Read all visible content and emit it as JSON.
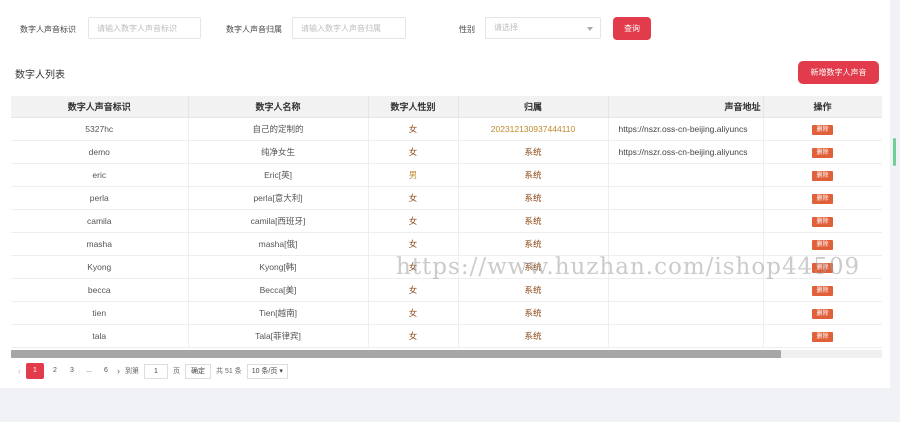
{
  "filters": {
    "id_label": "数字人声音标识",
    "id_placeholder": "请输入数字人声音标识",
    "owner_label": "数字人声音归属",
    "owner_placeholder": "请输入数字人声音归属",
    "gender_label": "性别",
    "gender_placeholder": "请选择",
    "search_button": "查询"
  },
  "section_title": "数字人列表",
  "add_button": "新增数字人声音",
  "table": {
    "headers": [
      "数字人声音标识",
      "数字人名称",
      "数字人性别",
      "归属",
      "声音地址",
      "操作"
    ],
    "rows": [
      {
        "id": "5327hc",
        "name": "自己的定制的",
        "gender": "女",
        "owner": "20231213093744411​0",
        "url": "https://nszr.oss-cn-beijing.aliyuncs",
        "action": "删除"
      },
      {
        "id": "demo",
        "name": "纯净女生",
        "gender": "女",
        "owner": "系统",
        "url": "https://nszr.oss-cn-beijing.aliyuncs",
        "action": "删除"
      },
      {
        "id": "eric",
        "name": "Eric[英]",
        "gender": "男",
        "owner": "系统",
        "url": "",
        "action": "删除"
      },
      {
        "id": "perla",
        "name": "perla[意大利]",
        "gender": "女",
        "owner": "系统",
        "url": "",
        "action": "删除"
      },
      {
        "id": "camila",
        "name": "camila[西班牙]",
        "gender": "女",
        "owner": "系统",
        "url": "",
        "action": "删除"
      },
      {
        "id": "masha",
        "name": "masha[俄]",
        "gender": "女",
        "owner": "系统",
        "url": "",
        "action": "删除"
      },
      {
        "id": "Kyong",
        "name": "Kyong[韩]",
        "gender": "女",
        "owner": "系统",
        "url": "",
        "action": "删除"
      },
      {
        "id": "becca",
        "name": "Becca[美]",
        "gender": "女",
        "owner": "系统",
        "url": "",
        "action": "删除"
      },
      {
        "id": "tien",
        "name": "Tien[越南]",
        "gender": "女",
        "owner": "系统",
        "url": "",
        "action": "删除"
      },
      {
        "id": "tala",
        "name": "Tala[菲律宾]",
        "gender": "女",
        "owner": "系统",
        "url": "",
        "action": "删除"
      }
    ]
  },
  "pagination": {
    "pages": [
      "1",
      "2",
      "3",
      "...",
      "6"
    ],
    "goto_label": "到第",
    "goto_value": "1",
    "page_unit": "页",
    "confirm": "确定",
    "total": "共 51 条",
    "page_size": "10 条/页"
  },
  "watermark": "https://www.huzhan.com/ishop44509",
  "colors": {
    "accent": "#e23b4b",
    "delete": "#e0603a",
    "gender_female": "#8b4513",
    "gender_male": "#c08a2e"
  }
}
